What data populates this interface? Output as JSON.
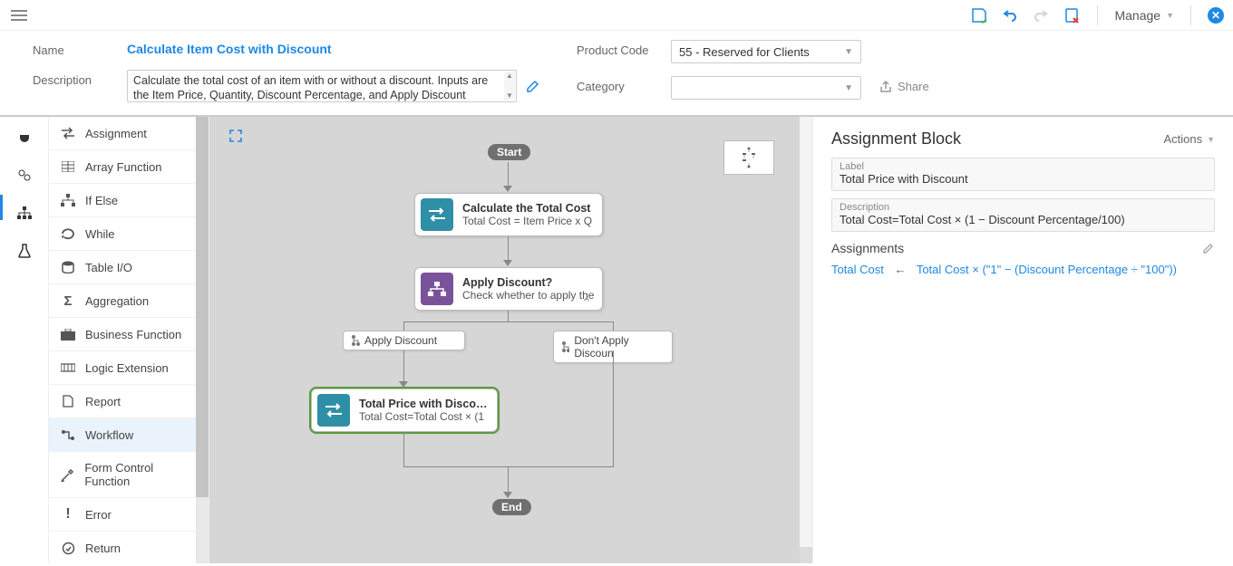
{
  "top": {
    "manage_label": "Manage"
  },
  "header": {
    "name_label": "Name",
    "name_value": "Calculate Item Cost with Discount",
    "desc_label": "Description",
    "desc_value": "Calculate the total cost of an item with or without a discount. Inputs are the Item Price, Quantity, Discount Percentage, and Apply Discount (True/False). The output is the Total Cost",
    "prodcode_label": "Product Code",
    "prodcode_value": "55 - Reserved for Clients",
    "category_label": "Category",
    "category_value": "",
    "share_label": "Share"
  },
  "palette": {
    "items": [
      {
        "label": "Assignment",
        "icon": "swap-icon"
      },
      {
        "label": "Array Function",
        "icon": "grid-icon"
      },
      {
        "label": "If Else",
        "icon": "branch-icon"
      },
      {
        "label": "While",
        "icon": "loop-icon"
      },
      {
        "label": "Table I/O",
        "icon": "db-icon"
      },
      {
        "label": "Aggregation",
        "icon": "sigma-icon"
      },
      {
        "label": "Business Function",
        "icon": "briefcase-icon"
      },
      {
        "label": "Logic Extension",
        "icon": "ext-icon"
      },
      {
        "label": "Report",
        "icon": "doc-icon"
      },
      {
        "label": "Workflow",
        "icon": "workflow-icon"
      },
      {
        "label": "Form Control Function",
        "icon": "tools-icon"
      },
      {
        "label": "Error",
        "icon": "exclaim-icon"
      },
      {
        "label": "Return",
        "icon": "return-icon"
      }
    ],
    "active_index": 9
  },
  "flow": {
    "start_label": "Start",
    "end_label": "End",
    "nodes": {
      "n1": {
        "title": "Calculate the Total Cost",
        "sub": "Total Cost = Item Price x Q"
      },
      "n2": {
        "title": "Apply Discount?",
        "sub": "Check whether to apply the"
      },
      "n3": {
        "title": "Total Price with Discount",
        "sub": "Total Cost=Total Cost × (1"
      }
    },
    "branches": {
      "left": "Apply Discount",
      "right": "Don't Apply Discoun"
    }
  },
  "inspector": {
    "title": "Assignment Block",
    "actions_label": "Actions",
    "label_label": "Label",
    "label_value": "Total Price with Discount",
    "desc_label": "Description",
    "desc_value": "Total Cost=Total Cost × (1 − Discount Percentage/100)",
    "assign_header": "Assignments",
    "expr_target": "Total Cost",
    "expr_source": "Total Cost × (\"1\" − (Discount Percentage ÷ \"100\"))"
  }
}
